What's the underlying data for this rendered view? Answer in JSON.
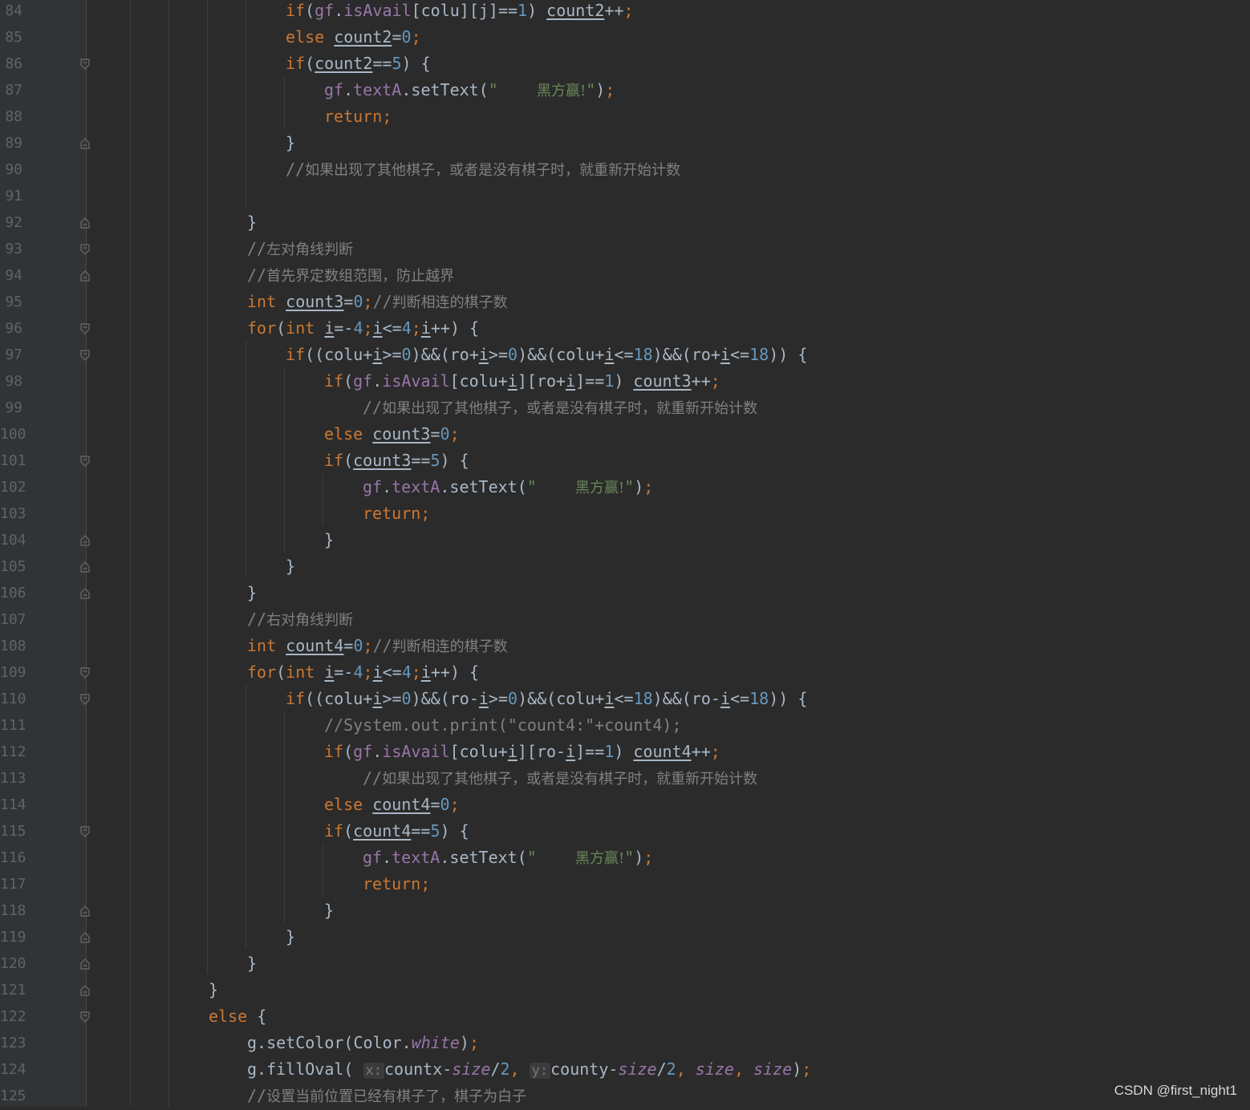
{
  "editor": {
    "lines": [
      {
        "n": "84",
        "indent": 3,
        "toks": [
          [
            "kw",
            "if"
          ],
          [
            "",
            "("
          ],
          [
            "fld",
            "gf"
          ],
          [
            "",
            "."
          ],
          [
            "fld",
            "isAvail"
          ],
          [
            "",
            "[colu][j]=="
          ],
          [
            "num",
            "1"
          ],
          [
            "",
            ") "
          ],
          [
            "u",
            "count2"
          ],
          [
            "",
            "++"
          ],
          [
            "kw",
            ";"
          ]
        ]
      },
      {
        "n": "85",
        "indent": 3,
        "toks": [
          [
            "kw",
            "else "
          ],
          [
            "u",
            "count2"
          ],
          [
            "",
            "="
          ],
          [
            "num",
            "0"
          ],
          [
            "kw",
            ";"
          ]
        ]
      },
      {
        "n": "86",
        "indent": 3,
        "toks": [
          [
            "kw",
            "if"
          ],
          [
            "",
            "("
          ],
          [
            "u",
            "count2"
          ],
          [
            "",
            "=="
          ],
          [
            "num",
            "5"
          ],
          [
            "",
            ") {"
          ]
        ]
      },
      {
        "n": "87",
        "indent": 4,
        "toks": [
          [
            "fld",
            "gf"
          ],
          [
            "",
            "."
          ],
          [
            "fld",
            "textA"
          ],
          [
            "",
            ".setText("
          ],
          [
            "str",
            "\"    "
          ],
          [
            "strzh",
            "黑方赢!"
          ],
          [
            "str",
            "\""
          ],
          [
            "",
            ")"
          ],
          [
            "kw",
            ";"
          ]
        ]
      },
      {
        "n": "88",
        "indent": 4,
        "toks": [
          [
            "kw",
            "return;"
          ]
        ]
      },
      {
        "n": "89",
        "indent": 3,
        "toks": [
          [
            "",
            "}"
          ]
        ]
      },
      {
        "n": "90",
        "indent": 3,
        "toks": [
          [
            "cmt",
            "//"
          ],
          [
            "cmtzh",
            "如果出现了其他棋子，或者是没有棋子时，就重新开始计数"
          ]
        ]
      },
      {
        "n": "91",
        "indent": 3,
        "toks": []
      },
      {
        "n": "92",
        "indent": 2,
        "toks": [
          [
            "",
            "}"
          ]
        ]
      },
      {
        "n": "93",
        "indent": 2,
        "toks": [
          [
            "cmt",
            "//"
          ],
          [
            "cmtzh",
            "左对角线判断"
          ]
        ]
      },
      {
        "n": "94",
        "indent": 2,
        "toks": [
          [
            "cmt",
            "//"
          ],
          [
            "cmtzh",
            "首先界定数组范围，防止越界"
          ]
        ]
      },
      {
        "n": "95",
        "indent": 2,
        "toks": [
          [
            "kw",
            "int "
          ],
          [
            "u",
            "count3"
          ],
          [
            "",
            "="
          ],
          [
            "num",
            "0"
          ],
          [
            "kw",
            ";"
          ],
          [
            "cmt",
            "//"
          ],
          [
            "cmtzh",
            "判断相连的棋子数"
          ]
        ]
      },
      {
        "n": "96",
        "indent": 2,
        "toks": [
          [
            "kw",
            "for"
          ],
          [
            "",
            "("
          ],
          [
            "kw",
            "int "
          ],
          [
            "u",
            "i"
          ],
          [
            "",
            "=-"
          ],
          [
            "num",
            "4"
          ],
          [
            "kw",
            ";"
          ],
          [
            "u",
            "i"
          ],
          [
            "",
            "<="
          ],
          [
            "num",
            "4"
          ],
          [
            "kw",
            ";"
          ],
          [
            "u",
            "i"
          ],
          [
            "",
            "++) {"
          ]
        ]
      },
      {
        "n": "97",
        "indent": 3,
        "toks": [
          [
            "kw",
            "if"
          ],
          [
            "",
            "((colu+"
          ],
          [
            "u",
            "i"
          ],
          [
            "",
            ">="
          ],
          [
            "num",
            "0"
          ],
          [
            "",
            ")&&(ro+"
          ],
          [
            "u",
            "i"
          ],
          [
            "",
            ">="
          ],
          [
            "num",
            "0"
          ],
          [
            "",
            ")&&(colu+"
          ],
          [
            "u",
            "i"
          ],
          [
            "",
            "<="
          ],
          [
            "num",
            "18"
          ],
          [
            "",
            ")&&(ro+"
          ],
          [
            "u",
            "i"
          ],
          [
            "",
            "<="
          ],
          [
            "num",
            "18"
          ],
          [
            "",
            ")) {"
          ]
        ]
      },
      {
        "n": "98",
        "indent": 4,
        "toks": [
          [
            "kw",
            "if"
          ],
          [
            "",
            "("
          ],
          [
            "fld",
            "gf"
          ],
          [
            "",
            "."
          ],
          [
            "fld",
            "isAvail"
          ],
          [
            "",
            "[colu+"
          ],
          [
            "u",
            "i"
          ],
          [
            "",
            "][ro+"
          ],
          [
            "u",
            "i"
          ],
          [
            "",
            "]=="
          ],
          [
            "num",
            "1"
          ],
          [
            "",
            ") "
          ],
          [
            "u",
            "count3"
          ],
          [
            "",
            "++"
          ],
          [
            "kw",
            ";"
          ]
        ]
      },
      {
        "n": "99",
        "indent": 5,
        "toks": [
          [
            "cmt",
            "//"
          ],
          [
            "cmtzh",
            "如果出现了其他棋子，或者是没有棋子时，就重新开始计数"
          ]
        ]
      },
      {
        "n": "100",
        "indent": 4,
        "toks": [
          [
            "kw",
            "else "
          ],
          [
            "u",
            "count3"
          ],
          [
            "",
            "="
          ],
          [
            "num",
            "0"
          ],
          [
            "kw",
            ";"
          ]
        ]
      },
      {
        "n": "101",
        "indent": 4,
        "toks": [
          [
            "kw",
            "if"
          ],
          [
            "",
            "("
          ],
          [
            "u",
            "count3"
          ],
          [
            "",
            "=="
          ],
          [
            "num",
            "5"
          ],
          [
            "",
            ") {"
          ]
        ]
      },
      {
        "n": "102",
        "indent": 5,
        "toks": [
          [
            "fld",
            "gf"
          ],
          [
            "",
            "."
          ],
          [
            "fld",
            "textA"
          ],
          [
            "",
            ".setText("
          ],
          [
            "str",
            "\"    "
          ],
          [
            "strzh",
            "黑方赢!"
          ],
          [
            "str",
            "\""
          ],
          [
            "",
            ")"
          ],
          [
            "kw",
            ";"
          ]
        ]
      },
      {
        "n": "103",
        "indent": 5,
        "toks": [
          [
            "kw",
            "return;"
          ]
        ]
      },
      {
        "n": "104",
        "indent": 4,
        "toks": [
          [
            "",
            "}"
          ]
        ]
      },
      {
        "n": "105",
        "indent": 3,
        "toks": [
          [
            "",
            "}"
          ]
        ]
      },
      {
        "n": "106",
        "indent": 2,
        "toks": [
          [
            "",
            "}"
          ]
        ]
      },
      {
        "n": "107",
        "indent": 2,
        "toks": [
          [
            "cmt",
            "//"
          ],
          [
            "cmtzh",
            "右对角线判断"
          ]
        ]
      },
      {
        "n": "108",
        "indent": 2,
        "toks": [
          [
            "kw",
            "int "
          ],
          [
            "u",
            "count4"
          ],
          [
            "",
            "="
          ],
          [
            "num",
            "0"
          ],
          [
            "kw",
            ";"
          ],
          [
            "cmt",
            "//"
          ],
          [
            "cmtzh",
            "判断相连的棋子数"
          ]
        ]
      },
      {
        "n": "109",
        "indent": 2,
        "toks": [
          [
            "kw",
            "for"
          ],
          [
            "",
            "("
          ],
          [
            "kw",
            "int "
          ],
          [
            "u",
            "i"
          ],
          [
            "",
            "=-"
          ],
          [
            "num",
            "4"
          ],
          [
            "kw",
            ";"
          ],
          [
            "u",
            "i"
          ],
          [
            "",
            "<="
          ],
          [
            "num",
            "4"
          ],
          [
            "kw",
            ";"
          ],
          [
            "u",
            "i"
          ],
          [
            "",
            "++) {"
          ]
        ]
      },
      {
        "n": "110",
        "indent": 3,
        "toks": [
          [
            "kw",
            "if"
          ],
          [
            "",
            "((colu+"
          ],
          [
            "u",
            "i"
          ],
          [
            "",
            ">="
          ],
          [
            "num",
            "0"
          ],
          [
            "",
            ")&&(ro-"
          ],
          [
            "u",
            "i"
          ],
          [
            "",
            ">="
          ],
          [
            "num",
            "0"
          ],
          [
            "",
            ")&&(colu+"
          ],
          [
            "u",
            "i"
          ],
          [
            "",
            "<="
          ],
          [
            "num",
            "18"
          ],
          [
            "",
            ")&&(ro-"
          ],
          [
            "u",
            "i"
          ],
          [
            "",
            "<="
          ],
          [
            "num",
            "18"
          ],
          [
            "",
            ")) {"
          ]
        ]
      },
      {
        "n": "111",
        "indent": 4,
        "toks": [
          [
            "cmt",
            "//System.out.print(\"count4:\"+count4);"
          ]
        ]
      },
      {
        "n": "112",
        "indent": 4,
        "toks": [
          [
            "kw",
            "if"
          ],
          [
            "",
            "("
          ],
          [
            "fld",
            "gf"
          ],
          [
            "",
            "."
          ],
          [
            "fld",
            "isAvail"
          ],
          [
            "",
            "[colu+"
          ],
          [
            "u",
            "i"
          ],
          [
            "",
            "][ro-"
          ],
          [
            "u",
            "i"
          ],
          [
            "",
            "]=="
          ],
          [
            "num",
            "1"
          ],
          [
            "",
            ") "
          ],
          [
            "u",
            "count4"
          ],
          [
            "",
            "++"
          ],
          [
            "kw",
            ";"
          ]
        ]
      },
      {
        "n": "113",
        "indent": 5,
        "toks": [
          [
            "cmt",
            "//"
          ],
          [
            "cmtzh",
            "如果出现了其他棋子，或者是没有棋子时，就重新开始计数"
          ]
        ]
      },
      {
        "n": "114",
        "indent": 4,
        "toks": [
          [
            "kw",
            "else "
          ],
          [
            "u",
            "count4"
          ],
          [
            "",
            "="
          ],
          [
            "num",
            "0"
          ],
          [
            "kw",
            ";"
          ]
        ]
      },
      {
        "n": "115",
        "indent": 4,
        "toks": [
          [
            "kw",
            "if"
          ],
          [
            "",
            "("
          ],
          [
            "u",
            "count4"
          ],
          [
            "",
            "=="
          ],
          [
            "num",
            "5"
          ],
          [
            "",
            ") {"
          ]
        ]
      },
      {
        "n": "116",
        "indent": 5,
        "toks": [
          [
            "fld",
            "gf"
          ],
          [
            "",
            "."
          ],
          [
            "fld",
            "textA"
          ],
          [
            "",
            ".setText("
          ],
          [
            "str",
            "\"    "
          ],
          [
            "strzh",
            "黑方赢!"
          ],
          [
            "str",
            "\""
          ],
          [
            "",
            ")"
          ],
          [
            "kw",
            ";"
          ]
        ]
      },
      {
        "n": "117",
        "indent": 5,
        "toks": [
          [
            "kw",
            "return;"
          ]
        ]
      },
      {
        "n": "118",
        "indent": 4,
        "toks": [
          [
            "",
            "}"
          ]
        ]
      },
      {
        "n": "119",
        "indent": 3,
        "toks": [
          [
            "",
            "}"
          ]
        ]
      },
      {
        "n": "120",
        "indent": 2,
        "toks": [
          [
            "",
            "}"
          ]
        ]
      },
      {
        "n": "121",
        "indent": 1,
        "toks": [
          [
            "",
            "}"
          ]
        ]
      },
      {
        "n": "122",
        "indent": 1,
        "toks": [
          [
            "kw",
            "else "
          ],
          [
            "",
            "{"
          ]
        ]
      },
      {
        "n": "123",
        "indent": 2,
        "toks": [
          [
            "",
            "g.setColor(Color."
          ],
          [
            "ital",
            "white"
          ],
          [
            "",
            ")"
          ],
          [
            "kw",
            ";"
          ]
        ]
      },
      {
        "n": "124",
        "indent": 2,
        "toks": [
          [
            "",
            "g.fillOval( "
          ],
          [
            "hint",
            "x:"
          ],
          [
            "",
            ""
          ],
          [
            "",
            "countx-"
          ],
          [
            "ital",
            "size"
          ],
          [
            "",
            "/"
          ],
          [
            "num",
            "2"
          ],
          [
            "kw",
            ", "
          ],
          [
            "hint",
            "y:"
          ],
          [
            "",
            "county-"
          ],
          [
            "ital",
            "size"
          ],
          [
            "",
            "/"
          ],
          [
            "num",
            "2"
          ],
          [
            "kw",
            ", "
          ],
          [
            "ital",
            "size"
          ],
          [
            "kw",
            ", "
          ],
          [
            "ital",
            "size"
          ],
          [
            "",
            ")"
          ],
          [
            "kw",
            ";"
          ]
        ]
      },
      {
        "n": "125",
        "indent": 2,
        "toks": [
          [
            "cmt",
            "//"
          ],
          [
            "cmtzh",
            "设置当前位置已经有棋子了，棋子为白子"
          ]
        ]
      }
    ]
  },
  "watermark": "CSDN @first_night1"
}
